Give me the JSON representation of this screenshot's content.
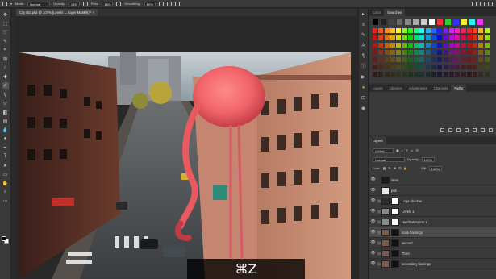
{
  "options_bar": {
    "mode_label": "Mode:",
    "mode_value": "Normal",
    "opacity_label": "Opacity:",
    "opacity_value": "14%",
    "flow_label": "Flow:",
    "flow_value": "18%",
    "smoothing_label": "Smoothing:",
    "smoothing_value": "10%"
  },
  "document_tab": {
    "title": "City BG.psd @ 107% (Levels 1, Layer Mask/8) *"
  },
  "panels": {
    "swatches_tabs": [
      "Color",
      "Swatches"
    ],
    "swatches_active": "Swatches",
    "adjust_tabs": [
      "Layers",
      "Libraries",
      "Adjustments",
      "Channels",
      "Paths"
    ],
    "adjust_active": "Paths",
    "layers_tabs": [
      "Layers"
    ],
    "layers_active": "Layers"
  },
  "layers_panel": {
    "kind_label": "Kind",
    "blend_mode": "Normal",
    "opacity_label": "Opacity:",
    "opacity_value": "100%",
    "lock_label": "Lock:",
    "fill_label": "Fill:",
    "fill_value": "100%",
    "layers": [
      {
        "name": "stars",
        "selected": false,
        "thumb": "#1a1a1a",
        "mask": null
      },
      {
        "name": "pull",
        "selected": false,
        "thumb": "#e8e8e8",
        "mask": null
      },
      {
        "name": "Logo shadow",
        "selected": false,
        "thumb": "#2a2a2a",
        "mask": "#ffffff"
      },
      {
        "name": "Levels 1",
        "selected": false,
        "thumb": "#8a8a8a",
        "mask": "#ffffff"
      },
      {
        "name": "Hue/Saturation 1",
        "selected": false,
        "thumb": "#8a8a8a",
        "mask": "#ffffff"
      },
      {
        "name": "main flamingo",
        "selected": true,
        "thumb": "#7a5a4a",
        "mask": "#111111"
      },
      {
        "name": "second",
        "selected": false,
        "thumb": "#7a5a4a",
        "mask": "#111111"
      },
      {
        "name": "Third",
        "selected": false,
        "thumb": "#7a5a4a",
        "mask": "#111111"
      },
      {
        "name": "secondary flamingo",
        "selected": false,
        "thumb": "#7a5a4a",
        "mask": "#111111"
      }
    ]
  },
  "shortcut_overlay": {
    "text": "⌘Z"
  },
  "colors": {
    "flamingo": "#f0646a",
    "panel_bg": "#3a3a3a",
    "canvas_bg": "#282828"
  }
}
